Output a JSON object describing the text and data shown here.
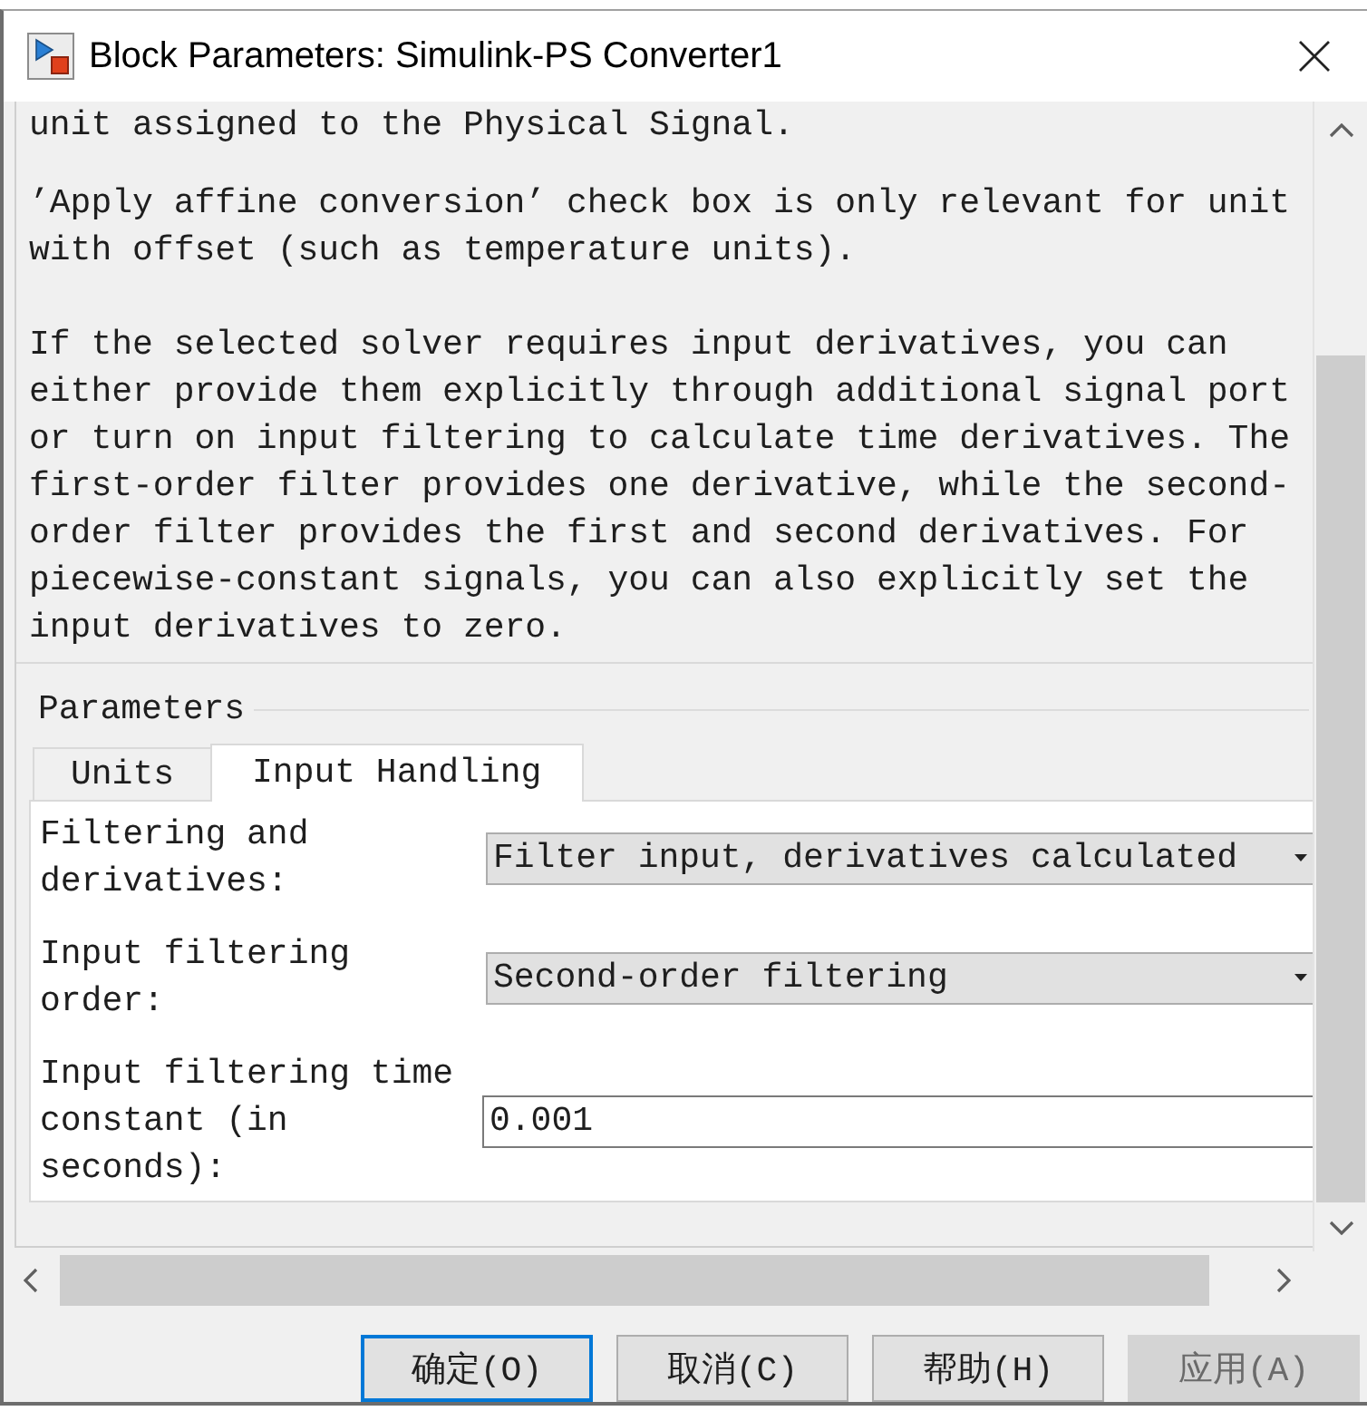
{
  "window": {
    "title": "Block Parameters: Simulink-PS Converter1"
  },
  "description": {
    "paragraphs": [
      "unit assigned to the Physical Signal.",
      "’Apply affine conversion’ check box is only relevant for unit\nwith offset (such as temperature units).",
      "If the selected solver requires input derivatives, you can\neither provide them explicitly through additional signal port\nor turn on input filtering to calculate time derivatives. The\nfirst-order filter provides one derivative, while the second-\norder filter provides the first and second derivatives. For\npiecewise-constant signals, you can also explicitly set the\ninput derivatives to zero."
    ]
  },
  "parameters": {
    "title": "Parameters",
    "tabs": [
      {
        "label": "Units",
        "selected": false
      },
      {
        "label": "Input Handling",
        "selected": true
      }
    ],
    "fields": [
      {
        "kind": "dropdown",
        "label": "Filtering and derivatives:",
        "value": "Filter input, derivatives calculated"
      },
      {
        "kind": "dropdown",
        "label": "Input filtering order:",
        "value": "Second-order filtering"
      },
      {
        "kind": "text",
        "label": "Input filtering time constant (in seconds):",
        "value": "0.001"
      }
    ]
  },
  "buttons": [
    {
      "label": "确定(O)",
      "focused": true,
      "disabled": false
    },
    {
      "label": "取消(C)",
      "focused": false,
      "disabled": false
    },
    {
      "label": "帮助(H)",
      "focused": false,
      "disabled": false
    },
    {
      "label": "应用(A)",
      "focused": false,
      "disabled": true
    }
  ]
}
